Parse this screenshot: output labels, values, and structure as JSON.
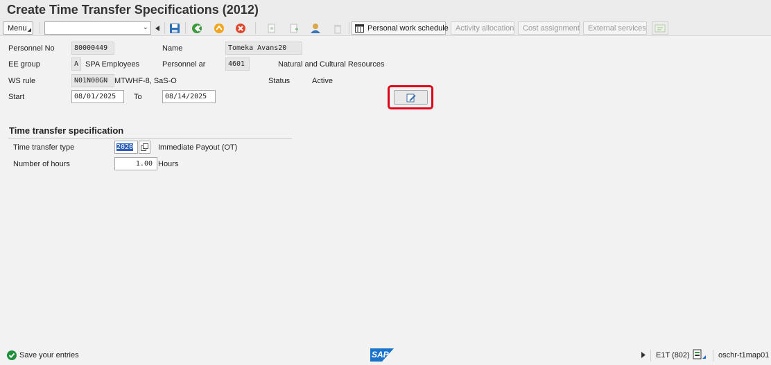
{
  "window": {
    "title": "Create Time Transfer Specifications (2012)"
  },
  "toolbar": {
    "menu_label": "Menu",
    "command_field_value": "",
    "buttons": {
      "personal_work_schedule": "Personal work schedule",
      "activity_allocation": "Activity allocation",
      "cost_assignment": "Cost assignment",
      "external_services": "External services"
    }
  },
  "header": {
    "personnel_no_label": "Personnel No",
    "personnel_no": "80000449",
    "name_label": "Name",
    "name": "Tomeka Avans20",
    "ee_group_label": "EE group",
    "ee_group_code": "A",
    "ee_group_text": "SPA Employees",
    "personnel_area_label": "Personnel ar",
    "personnel_area_code": "4601",
    "personnel_area_text": "Natural and Cultural Resources",
    "ws_rule_label": "WS rule",
    "ws_rule_code": "N01N08GN",
    "ws_rule_text": "MTWHF-8, SaS-O",
    "status_label": "Status",
    "status_value": "Active",
    "start_label": "Start",
    "start_date": "08/01/2025",
    "to_label": "To",
    "end_date": "08/14/2025"
  },
  "section": {
    "title": "Time transfer specification",
    "type_label": "Time transfer type",
    "type_code": "2020",
    "type_text": "Immediate Payout (OT)",
    "hours_label": "Number of hours",
    "hours_value": "1.00",
    "hours_unit": "Hours"
  },
  "statusbar": {
    "message": "Save your entries",
    "system": "E1T (802)",
    "server": "oschr-t1map01",
    "logo_text": "SAP"
  },
  "colors": {
    "highlight": "#e1001a",
    "success": "#1e8f3a",
    "sap_blue": "#1a73c9"
  }
}
